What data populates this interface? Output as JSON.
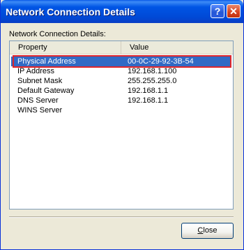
{
  "window": {
    "title": "Network Connection Details",
    "help_glyph": "?",
    "close_glyph": "✕"
  },
  "content": {
    "label": "Network Connection Details:",
    "columns": {
      "property": "Property",
      "value": "Value"
    },
    "rows": [
      {
        "property": "Physical Address",
        "value": "00-0C-29-92-3B-54",
        "selected": true
      },
      {
        "property": "IP Address",
        "value": "192.168.1.100"
      },
      {
        "property": "Subnet Mask",
        "value": "255.255.255.0"
      },
      {
        "property": "Default Gateway",
        "value": "192.168.1.1"
      },
      {
        "property": "DNS Server",
        "value": "192.168.1.1"
      },
      {
        "property": "WINS Server",
        "value": ""
      }
    ]
  },
  "footer": {
    "close_first": "C",
    "close_rest": "lose"
  },
  "colors": {
    "selection": "#316ac5",
    "highlight_border": "#e0262b"
  }
}
